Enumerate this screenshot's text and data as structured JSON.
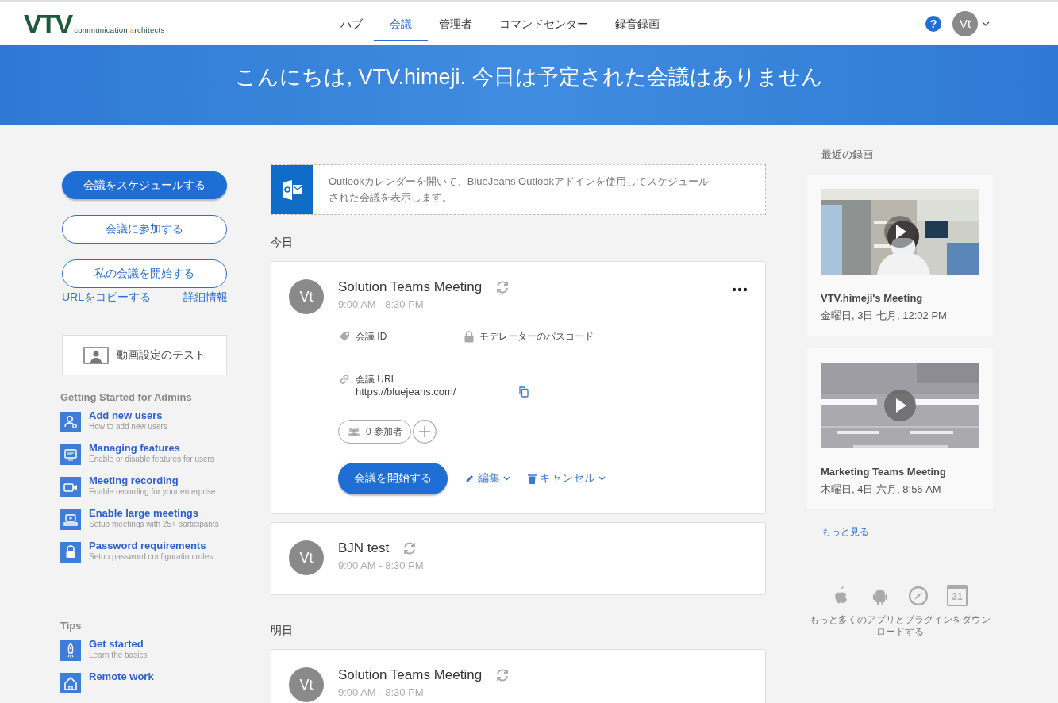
{
  "header": {
    "logo": {
      "mark": "VTV",
      "tagline": [
        {
          "text": "communication ",
          "accent": false
        },
        {
          "text": "a",
          "accent": true
        },
        {
          "text": "rchitects",
          "accent": false
        }
      ]
    },
    "tabs": [
      {
        "label": "ハブ",
        "selected": false
      },
      {
        "label": "会議",
        "selected": true
      },
      {
        "label": "管理者",
        "selected": false
      },
      {
        "label": "コマンドセンター",
        "selected": false
      },
      {
        "label": "録音録画",
        "selected": false
      }
    ],
    "help": "?",
    "avatar": "Vt"
  },
  "banner": {
    "greeting": "こんにちは, VTV.himeji. 今日は予定された会議はありません"
  },
  "sidebar": {
    "buttons": [
      {
        "label": "会議をスケジュールする",
        "kind": "primary"
      },
      {
        "label": "会議に参加する",
        "kind": "outline"
      },
      {
        "label": "私の会議を開始する",
        "kind": "outline"
      }
    ],
    "links": [
      "URLをコピーする",
      "詳細情報"
    ],
    "video_test": "動画設定のテスト",
    "sections": [
      {
        "title": "Getting Started for Admins",
        "items": [
          {
            "title": "Add new users",
            "subtitle": "How to add new users"
          },
          {
            "title": "Managing features",
            "subtitle": "Enable or disable features for users"
          },
          {
            "title": "Meeting recording",
            "subtitle": "Enable recording for your enterprise"
          },
          {
            "title": "Enable large meetings",
            "subtitle": "Setup meetings with 25+ participants"
          },
          {
            "title": "Password requirements",
            "subtitle": "Setup password configuration rules"
          }
        ]
      },
      {
        "title": "Tips",
        "items": [
          {
            "title": "Get started",
            "subtitle": "Learn the basics"
          },
          {
            "title": "Remote work"
          }
        ]
      }
    ]
  },
  "outlook_notice": "Outlookカレンダーを開いて、BlueJeans Outlookアドインを使用してスケジュールされた会議を表示します。",
  "groups": [
    {
      "label": "今日",
      "meetings": [
        {
          "avatar": "Vt",
          "title": "Solution Teams Meeting",
          "time": "9:00 AM - 8:30 PM",
          "recurring": true,
          "expanded": true,
          "details": {
            "id_label": "会議 ID",
            "passcode_label": "モデレーターのパスコード",
            "url_label": "会議 URL",
            "url": "https://bluejeans.com/",
            "participants": "0 参加者",
            "start": "会議を開始する",
            "edit": "編集",
            "cancel": "キャンセル"
          }
        },
        {
          "avatar": "Vt",
          "title": "BJN test",
          "time": "9:00 AM - 8:30 PM",
          "recurring": true,
          "expanded": false
        }
      ]
    },
    {
      "label": "明日",
      "meetings": [
        {
          "avatar": "Vt",
          "title": "Solution Teams Meeting",
          "time": "9:00 AM - 8:30 PM",
          "recurring": true,
          "expanded": false
        }
      ]
    }
  ],
  "recordings": {
    "title": "最近の録画",
    "items": [
      {
        "title": "VTV.himeji's Meeting",
        "date": "金曜日, 3日 七月, 12:02 PM"
      },
      {
        "title": "Marketing Teams Meeting",
        "date": "木曜日, 4日 六月, 8:56 AM"
      }
    ],
    "more": "もっと見る",
    "calendar_day": "31",
    "apps_text": "もっと多くのアプリとプラグインをダウンロードする"
  }
}
